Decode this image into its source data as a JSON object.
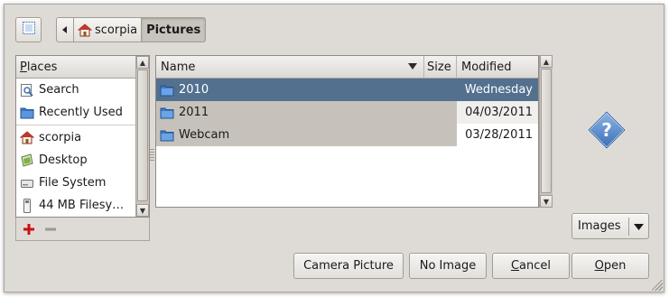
{
  "toolbar": {
    "toggle_location_icon": "edit-location-icon",
    "back_arrow_icon": "left-arrow-icon"
  },
  "pathbar": {
    "segments": [
      {
        "label": "scorpia",
        "icon": "home-icon"
      },
      {
        "label": "Pictures",
        "active": true
      }
    ]
  },
  "places": {
    "header": "Places",
    "items": [
      {
        "label": "Search",
        "icon": "search-icon"
      },
      {
        "label": "Recently Used",
        "icon": "folder-icon"
      },
      {
        "label": "scorpia",
        "icon": "home-icon"
      },
      {
        "label": "Desktop",
        "icon": "desktop-icon"
      },
      {
        "label": "File System",
        "icon": "drive-icon"
      },
      {
        "label": "44 MB Filesy…",
        "icon": "removable-drive-icon"
      }
    ],
    "add_icon": "plus-icon",
    "remove_icon": "minus-icon"
  },
  "files": {
    "columns": {
      "name": "Name",
      "size": "Size",
      "modified": "Modified"
    },
    "rows": [
      {
        "name": "2010",
        "size": "",
        "modified": "Wednesday",
        "icon": "folder-icon"
      },
      {
        "name": "2011",
        "size": "",
        "modified": "04/03/2011",
        "icon": "folder-icon"
      },
      {
        "name": "Webcam",
        "size": "",
        "modified": "03/28/2011",
        "icon": "folder-icon"
      }
    ]
  },
  "preview": {
    "icon": "question-icon"
  },
  "filter": {
    "selected": "Images"
  },
  "buttons": {
    "camera": "Camera Picture",
    "no_image": "No Image",
    "cancel": "Cancel",
    "open": "Open"
  },
  "colors": {
    "selection": "#53708f",
    "dialog_bg": "#dedbd6",
    "accent_red": "#cc1111"
  }
}
